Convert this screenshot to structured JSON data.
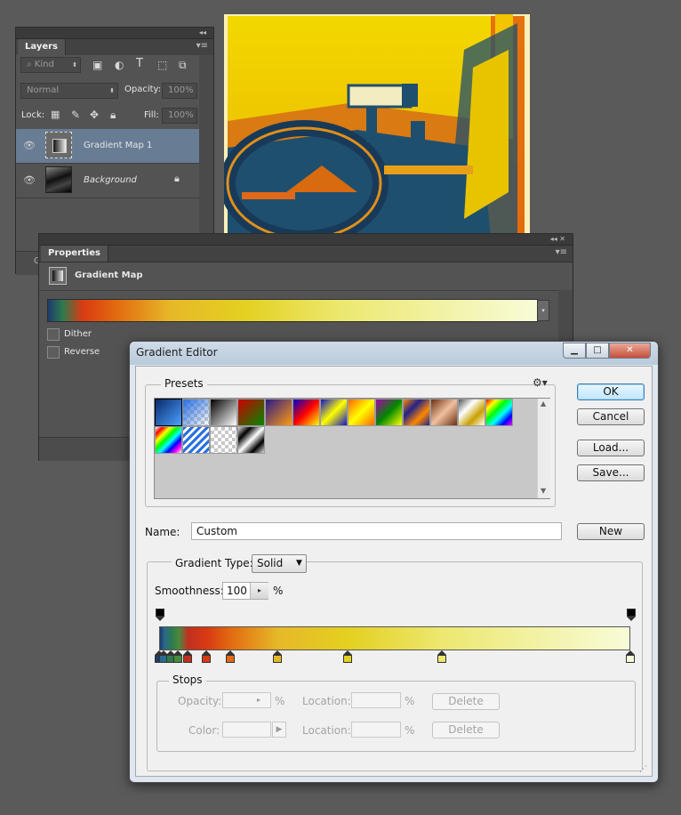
{
  "layers_panel": {
    "tab": "Layers",
    "kind_filter": "Kind",
    "blend_mode": "Normal",
    "opacity_label": "Opacity:",
    "opacity_value": "100%",
    "lock_label": "Lock:",
    "fill_label": "Fill:",
    "fill_value": "100%",
    "layers": [
      {
        "name": "Gradient Map 1",
        "visible": true,
        "selected": true
      },
      {
        "name": "Background",
        "visible": true,
        "locked": true
      }
    ],
    "footer_glyph": "G"
  },
  "properties_panel": {
    "tab": "Properties",
    "title": "Gradient Map",
    "dither_label": "Dither",
    "dither_checked": false,
    "reverse_label": "Reverse",
    "reverse_checked": false
  },
  "gradient_editor": {
    "title": "Gradient Editor",
    "presets_label": "Presets",
    "buttons": {
      "ok": "OK",
      "cancel": "Cancel",
      "load": "Load...",
      "save": "Save...",
      "new": "New"
    },
    "name_label": "Name:",
    "name_value": "Custom",
    "gradient_type_label": "Gradient Type:",
    "gradient_type_value": "Solid",
    "smoothness_label": "Smoothness:",
    "smoothness_value": "100",
    "smoothness_unit": "%",
    "stops_label": "Stops",
    "opacity_label": "Opacity:",
    "color_label": "Color:",
    "location_label": "Location:",
    "percent": "%",
    "delete_label": "Delete",
    "color_stops": [
      {
        "location": 0,
        "color": "#1e3b6e"
      },
      {
        "location": 1,
        "color": "#2a6a8a"
      },
      {
        "location": 2.5,
        "color": "#2e7a4e"
      },
      {
        "location": 4,
        "color": "#4a8a3e"
      },
      {
        "location": 6,
        "color": "#c03020"
      },
      {
        "location": 10,
        "color": "#d83a12"
      },
      {
        "location": 15,
        "color": "#e26a10"
      },
      {
        "location": 25,
        "color": "#e6b828"
      },
      {
        "location": 40,
        "color": "#e4d020"
      },
      {
        "location": 60,
        "color": "#ece870"
      },
      {
        "location": 100,
        "color": "#f8fcd8"
      }
    ],
    "opacity_stops": [
      0,
      100
    ]
  }
}
